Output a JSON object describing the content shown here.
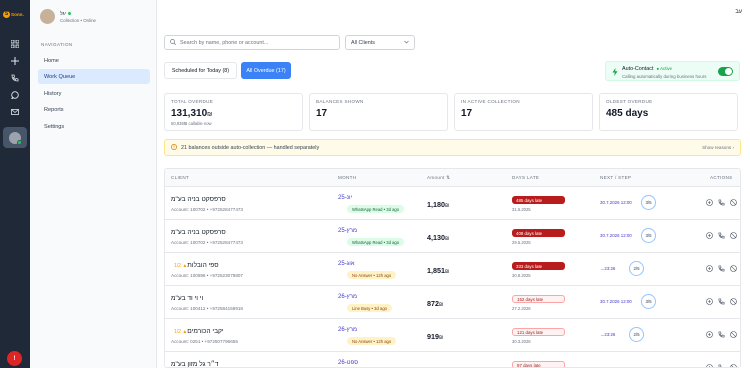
{
  "rail": {
    "logo_text": "Sonn.",
    "logo_mark": "S",
    "icons": [
      "grid-icon",
      "plus-icon",
      "phone-icon",
      "chat-icon",
      "mail-icon"
    ],
    "alert_count": "!"
  },
  "profile": {
    "name": "יגל",
    "status": "Collection • Online"
  },
  "nav": {
    "label": "NAVIGATION",
    "items": [
      "Home",
      "Work Queue",
      "History",
      "Reports",
      "Settings"
    ]
  },
  "header": {
    "lang": "עב"
  },
  "search": {
    "placeholder": "Search by name, phone or account..."
  },
  "filter": {
    "selected": "All Clients"
  },
  "tabs": {
    "scheduled": "Scheduled for Today (8)",
    "overdue": "All Overdue (17)"
  },
  "auto_contact": {
    "title": "Auto-Contact",
    "state": "● Active",
    "subtitle": "Calling automatically during business hours"
  },
  "stats": [
    {
      "label": "TOTAL OVERDUE",
      "value": "131,310",
      "currency": "₪",
      "sub": "50,936₪ callable now"
    },
    {
      "label": "BALANCES SHOWN",
      "value": "17"
    },
    {
      "label": "IN ACTIVE COLLECTION",
      "value": "17"
    },
    {
      "label": "OLDEST OVERDUE",
      "value": "485 days"
    }
  ],
  "banner": {
    "text": "21 balances outside auto-collection — handled separately",
    "action": "Show reasons"
  },
  "table": {
    "headers": {
      "client": "CLIENT",
      "month": "MONTH",
      "amount": "Amount ⇅",
      "days": "DAYS LATE",
      "next": "NEXT / STEP",
      "actions": "ACTIONS"
    },
    "rows": [
      {
        "name": "סרפסקט בניה בע\"מ",
        "flag": "",
        "account": "Account: 100702  •  +972528477473",
        "month": "יונ-25",
        "badge": "WhatsApp Read • 3d ago",
        "badge_type": "green",
        "amount": "1,180",
        "late": "485 days late",
        "late_type": "red",
        "date": "31.5.2025",
        "next": "30.7.2026 12:00",
        "step": "3/5"
      },
      {
        "name": "סרפסקט בניה בע\"מ",
        "flag": "",
        "account": "Account: 100702  •  +972528477473",
        "month": "מרץ-25",
        "badge": "WhatsApp Read • 3d ago",
        "badge_type": "green",
        "amount": "4,130",
        "late": "408 days late",
        "late_type": "red",
        "date": "29.5.2025",
        "next": "30.7.2026 12:00",
        "step": "3/5"
      },
      {
        "name": "ספי הובלות",
        "flag": "▲ 1/2",
        "account": "Account: 100596  •  +972523078807",
        "month": "אוג-25",
        "badge": "No Answer • 12h ago",
        "badge_type": "yellow",
        "amount": "1,851",
        "late": "333 days late",
        "late_type": "red",
        "date": "30.8.2025",
        "next": "→23:26",
        "step": "2/5"
      },
      {
        "name": "וי וי וד בע\"מ",
        "flag": "",
        "account": "Account: 100412  •  +972584159918",
        "month": "מרץ-26",
        "badge": "Line Busy • 3d ago",
        "badge_type": "yellow",
        "amount": "872",
        "late": "152 days late",
        "late_type": "light",
        "date": "27.2.2026",
        "next": "30.7.2026 12:00",
        "step": "3/5"
      },
      {
        "name": "יקבי הכורמים",
        "flag": "▲ 1/2",
        "account": "Account: 0251  •  +972507796655",
        "month": "מרץ-26",
        "badge": "No Answer • 12h ago",
        "badge_type": "yellow",
        "amount": "919",
        "late": "121 days late",
        "late_type": "light",
        "date": "30.3.2026",
        "next": "→23:26",
        "step": "2/5"
      },
      {
        "name": "ד״ר גל מזון בע\"מ",
        "flag": "",
        "account": "",
        "month": "ספט-26",
        "badge": "",
        "badge_type": "",
        "amount": "",
        "late": "97 days late",
        "late_type": "light",
        "date": "",
        "next": "",
        "step": ""
      }
    ]
  },
  "colors": {
    "primary": "#3b82f6",
    "danger": "#b91c1c",
    "success": "#16a34a",
    "rail": "#1f2937"
  }
}
